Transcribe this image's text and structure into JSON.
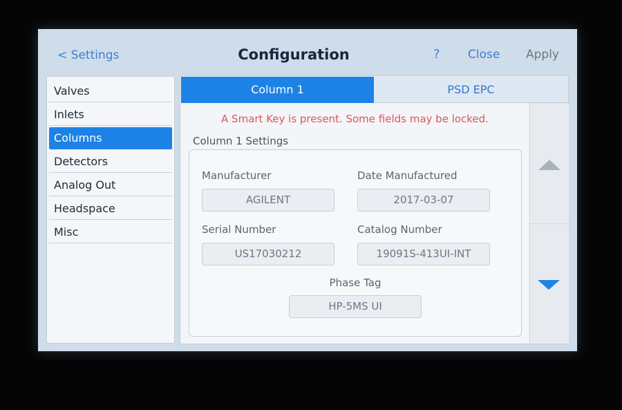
{
  "header": {
    "back_label": "< Settings",
    "title": "Configuration",
    "help_label": "?",
    "close_label": "Close",
    "apply_label": "Apply"
  },
  "sidebar": {
    "items": [
      {
        "label": "Valves",
        "active": false
      },
      {
        "label": "Inlets",
        "active": false
      },
      {
        "label": "Columns",
        "active": true
      },
      {
        "label": "Detectors",
        "active": false
      },
      {
        "label": "Analog Out",
        "active": false
      },
      {
        "label": "Headspace",
        "active": false
      },
      {
        "label": "Misc",
        "active": false
      }
    ]
  },
  "tabs": [
    {
      "label": "Column 1",
      "active": true
    },
    {
      "label": "PSD EPC",
      "active": false
    }
  ],
  "content": {
    "warning": "A Smart Key is present. Some fields may be locked.",
    "section_title": "Column 1 Settings",
    "fields": {
      "manufacturer": {
        "label": "Manufacturer",
        "value": "AGILENT"
      },
      "date_manufactured": {
        "label": "Date Manufactured",
        "value": "2017-03-07"
      },
      "serial_number": {
        "label": "Serial Number",
        "value": "US17030212"
      },
      "catalog_number": {
        "label": "Catalog Number",
        "value": "19091S-413UI-INT"
      },
      "phase_tag": {
        "label": "Phase Tag",
        "value": "HP-5MS UI"
      }
    }
  },
  "scroll": {
    "up_icon": "triangle-up-icon",
    "down_icon": "triangle-down-icon"
  },
  "colors": {
    "accent": "#1d82e6",
    "link": "#3f7fd0",
    "warning": "#d9585b"
  }
}
